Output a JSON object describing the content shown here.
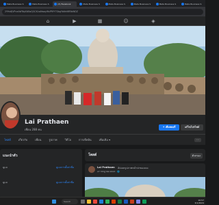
{
  "browser": {
    "tabs": [
      {
        "label": "Meta Business S",
        "active": false
      },
      {
        "label": "Meta Business S",
        "active": false
      },
      {
        "label": "(3) Facebook",
        "active": true
      },
      {
        "label": "Meta Business S",
        "active": false
      },
      {
        "label": "Meta Business S",
        "active": false
      },
      {
        "label": "Meta Business S",
        "active": false
      },
      {
        "label": "Meta Business S",
        "active": false
      },
      {
        "label": "Meta Business S",
        "active": false
      }
    ],
    "url": "2YHv6JVPcw0sFBqXWAzQGCKLwNwayWsPRYY7GbgYbNnNR5bWDZ"
  },
  "profile": {
    "name": "Lai Prathaen",
    "friends": "เพื่อน 288 คน",
    "add_story": "+ เพิ่มสตอรี่",
    "edit_profile": "แก้ไขโปรไฟล์"
  },
  "profile_tabs": [
    "โพสต์",
    "เกี่ยวกับ",
    "เพื่อน",
    "รูปภาพ",
    "วิดีโอ",
    "การเช็คอิน",
    "เพิ่มเติม ▾"
  ],
  "profile_tabs_more": "···",
  "left_card": {
    "title": "แนะนำตัว",
    "row1_label": "ดูแล",
    "row1_link": "ดูแลการตั้งค่าชื่อ",
    "row2_label": "ดูแล",
    "row2_link": "ดูแลการตั้งค่าชื่อ"
  },
  "right_card": {
    "title": "โพสต์",
    "filter": "ตัวกรอง"
  },
  "post": {
    "author": "Lai Prathaen",
    "action": "อัปเดตรูปภาพหน้าปกของเธอ",
    "date": "27 กรกฎาคม 2023 · 🌐"
  },
  "taskbar": {
    "search": "Search",
    "time": "10:57",
    "date": "3/1/2024"
  }
}
